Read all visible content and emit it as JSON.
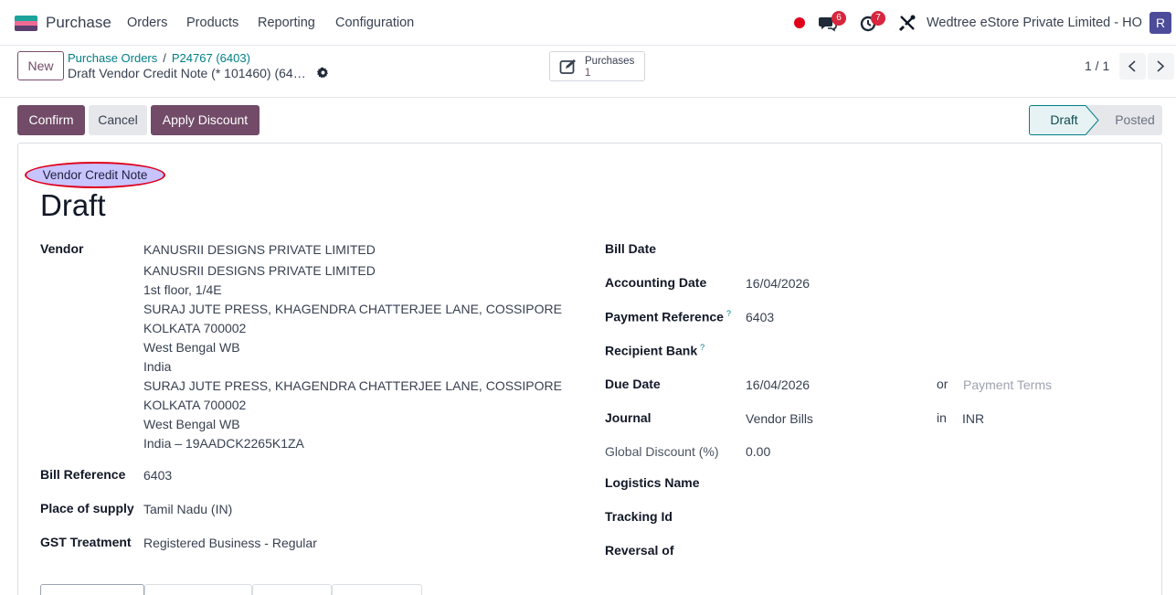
{
  "navbar": {
    "app_name": "Purchase",
    "menu": [
      "Orders",
      "Products",
      "Reporting",
      "Configuration"
    ],
    "messages_count": "6",
    "activities_count": "7",
    "company": "Wedtree eStore Private Limited - HO",
    "avatar_letter": "R"
  },
  "control_panel": {
    "new_label": "New",
    "breadcrumb": [
      "Purchase Orders",
      "P24767 (6403)"
    ],
    "breadcrumb_sep": "/",
    "record_title": "Draft Vendor Credit Note (* 101460) (64…",
    "smart_button": {
      "label": "Purchases",
      "count": "1"
    },
    "pager": "1 / 1"
  },
  "actions": {
    "confirm": "Confirm",
    "cancel": "Cancel",
    "apply_discount": "Apply Discount"
  },
  "status": {
    "current": "Draft",
    "next": "Posted"
  },
  "form": {
    "type_badge": "Vendor Credit Note",
    "title": "Draft",
    "left": {
      "vendor_label": "Vendor",
      "vendor_name": "KANUSRII DESIGNS PRIVATE LIMITED",
      "address_lines": [
        "KANUSRII DESIGNS PRIVATE LIMITED",
        "1st floor, 1/4E",
        "SURAJ JUTE PRESS, KHAGENDRA CHATTERJEE LANE, COSSIPORE",
        "KOLKATA 700002",
        "West Bengal WB",
        "India",
        "SURAJ JUTE PRESS, KHAGENDRA CHATTERJEE LANE, COSSIPORE",
        "KOLKATA 700002",
        "West Bengal WB",
        "India – 19AADCK2265K1ZA"
      ],
      "bill_reference_label": "Bill Reference",
      "bill_reference": "6403",
      "place_of_supply_label": "Place of supply",
      "place_of_supply": "Tamil Nadu (IN)",
      "gst_treatment_label": "GST Treatment",
      "gst_treatment": "Registered Business - Regular"
    },
    "right": {
      "bill_date_label": "Bill Date",
      "accounting_date_label": "Accounting Date",
      "accounting_date": "16/04/2026",
      "payment_reference_label": "Payment Reference",
      "payment_reference": "6403",
      "help_mark": "?",
      "recipient_bank_label": "Recipient Bank",
      "due_date_label": "Due Date",
      "due_date": "16/04/2026",
      "or_label": "or",
      "payment_terms_placeholder": "Payment Terms",
      "journal_label": "Journal",
      "journal": "Vendor Bills",
      "in_label": "in",
      "currency": "INR",
      "global_discount_label": "Global Discount (%)",
      "global_discount": "0.00",
      "logistics_name_label": "Logistics Name",
      "tracking_id_label": "Tracking Id",
      "reversal_of_label": "Reversal of"
    }
  },
  "colors": {
    "brand": "#714b67",
    "link": "#017e84",
    "badge_red": "#d7263d",
    "highlight_fill": "#c7c4ff",
    "highlight_ring": "#e0001b"
  }
}
